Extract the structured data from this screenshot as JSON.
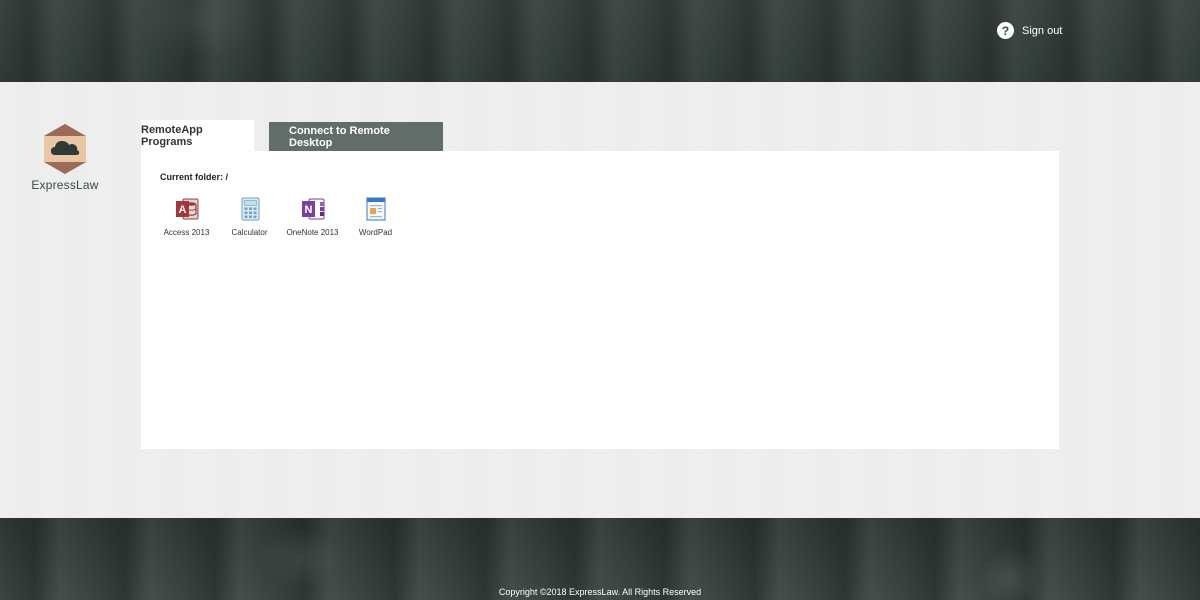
{
  "header": {
    "signout_label": "Sign out",
    "help_symbol": "?"
  },
  "brand": {
    "name": "ExpressLaw",
    "logo_icon": "cloud-hexagon-icon",
    "colors": {
      "hexagon_top": "#9c6a56",
      "hexagon_mid": "#e8c7a4",
      "cloud": "#2f3a37"
    }
  },
  "tabs": [
    {
      "label": "RemoteApp Programs",
      "active": true
    },
    {
      "label": "Connect to Remote Desktop",
      "active": false
    }
  ],
  "panel": {
    "current_folder": "Current folder: /"
  },
  "apps": [
    {
      "label": "Access 2013",
      "icon": "access-icon",
      "color": "#a4373a"
    },
    {
      "label": "Calculator",
      "icon": "calculator-icon",
      "color": "#6fa3c8"
    },
    {
      "label": "OneNote 2013",
      "icon": "onenote-icon",
      "color": "#7b3f9e"
    },
    {
      "label": "WordPad",
      "icon": "wordpad-icon",
      "color": "#3a78c3"
    }
  ],
  "footer": {
    "copyright": "Copyright ©2018 ExpressLaw. All Rights Reserved"
  },
  "theme": {
    "dark_band": "#333d3a",
    "content_bg": "#efefef",
    "tab_inactive_bg": "#626c69"
  }
}
